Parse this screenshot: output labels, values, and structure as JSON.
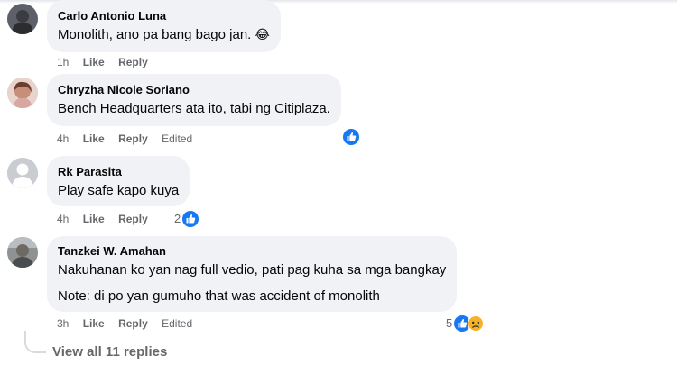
{
  "comments": [
    {
      "author": "Carlo Antonio Luna",
      "lines": [
        "Monolith, ano pa bang bago jan."
      ],
      "emoji": "😂",
      "time": "1h",
      "like": "Like",
      "reply": "Reply",
      "edited": "",
      "reaction_count": "",
      "reactions": []
    },
    {
      "author": "Chryzha Nicole Soriano",
      "lines": [
        "Bench Headquarters ata ito, tabi ng Citiplaza."
      ],
      "time": "4h",
      "like": "Like",
      "reply": "Reply",
      "edited": "Edited",
      "reaction_count": "",
      "reactions": [
        "like-icon"
      ]
    },
    {
      "author": "Rk Parasita",
      "lines": [
        "Play safe kapo kuya"
      ],
      "time": "4h",
      "like": "Like",
      "reply": "Reply",
      "edited": "",
      "reaction_count": "2",
      "reactions": [
        "like-icon"
      ]
    },
    {
      "author": "Tanzkei W. Amahan",
      "lines": [
        "Nakuhanan ko yan nag full vedio, pati pag kuha sa mga bangkay",
        "Note: di po yan gumuho that was accident of monolith"
      ],
      "time": "3h",
      "like": "Like",
      "reply": "Reply",
      "edited": "Edited",
      "reaction_count": "5",
      "reactions": [
        "like-icon",
        "sad-icon"
      ]
    }
  ],
  "view_replies": "View all 11 replies",
  "colors": {
    "bubble": "#f0f2f5",
    "meta_text": "#65676b",
    "like_blue": "#1877f2",
    "sad_yellow": "#f7b125"
  }
}
